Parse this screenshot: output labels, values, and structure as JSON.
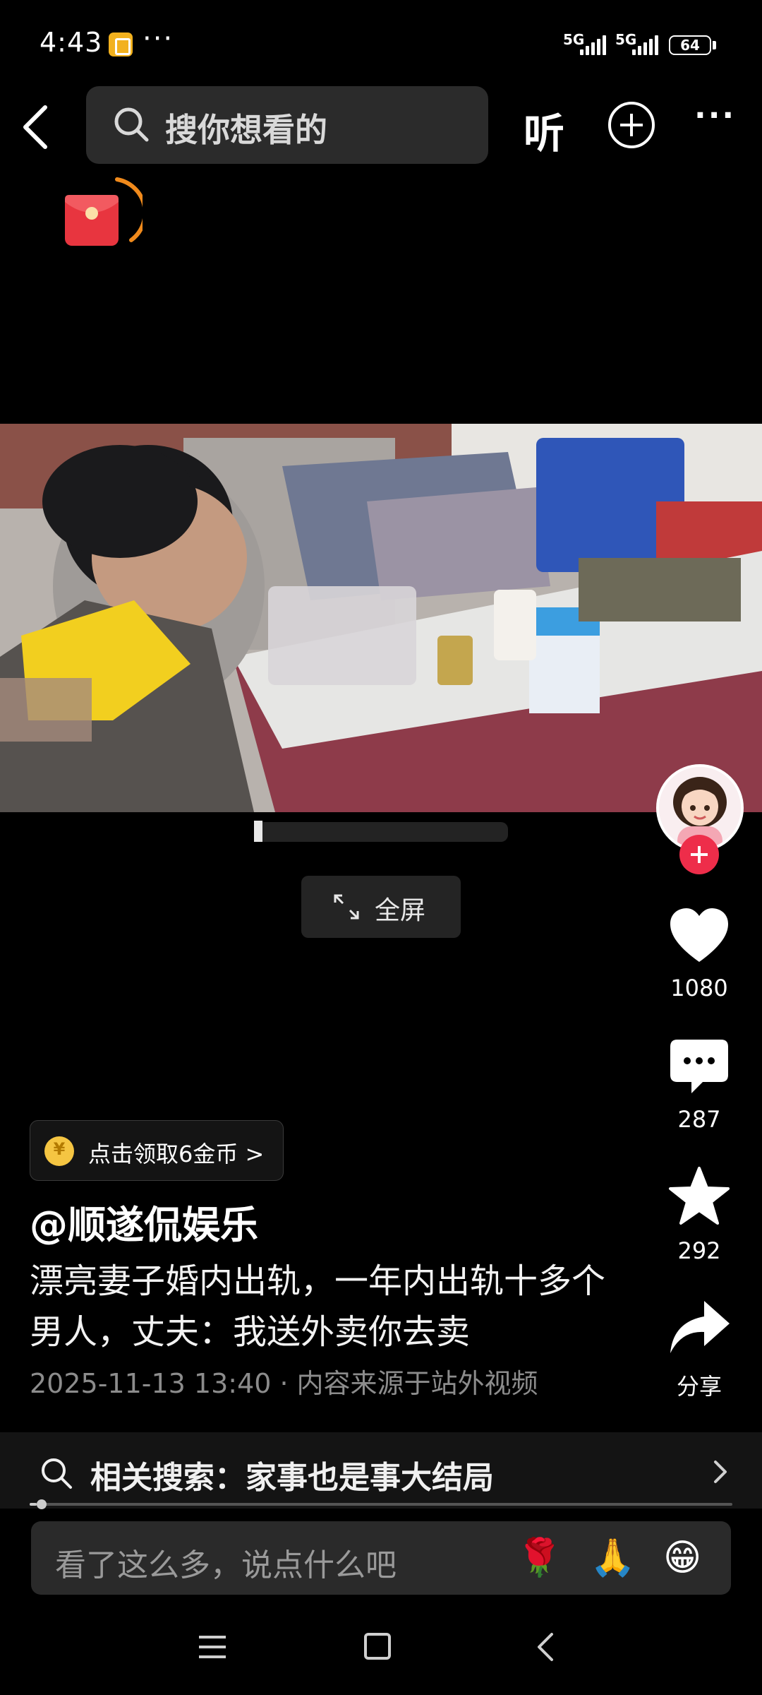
{
  "status_bar": {
    "time": "4:43",
    "dots": "···",
    "signal1": "5G",
    "signal2": "5G",
    "battery": "64"
  },
  "top_bar": {
    "search_placeholder": "搜你想看的",
    "listen_label": "听",
    "more_label": "···"
  },
  "video": {
    "fullscreen_label": "全屏"
  },
  "right_rail": {
    "likes": "1080",
    "comments": "287",
    "favorites": "292",
    "share_label": "分享"
  },
  "info": {
    "coin_banner": "点击领取6金币 >",
    "author": "@顺遂侃娱乐",
    "caption": "漂亮妻子婚内出轨，一年内出轨十多个男人，丈夫：我送外卖你去卖",
    "date": "2025-11-13 13:40",
    "dot": "·",
    "source": "内容来源于站外视频"
  },
  "related_search": {
    "text": "相关搜索：家事也是事大结局",
    "progress": 0.01
  },
  "comment_bar": {
    "placeholder": "看了这么多，说点什么吧",
    "emojis": [
      "🌹",
      "🙏",
      "😁"
    ]
  },
  "colors": {
    "background": "#000000",
    "accent_red": "#ee2d4a",
    "search_bg": "#2b2b2b",
    "coin": "#f5c542"
  },
  "icons": [
    "back-icon",
    "search-icon",
    "add-icon",
    "red-packet-icon",
    "fullscreen-icon",
    "heart-icon",
    "comment-icon",
    "star-icon",
    "share-icon",
    "menu-icon",
    "home-icon",
    "nav-back-icon"
  ]
}
